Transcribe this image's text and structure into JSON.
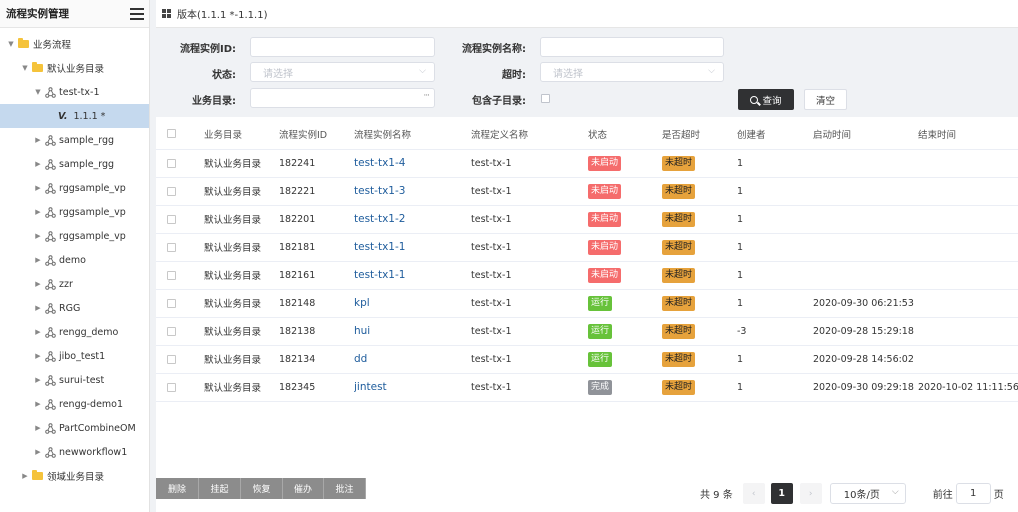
{
  "sidebar": {
    "title": "流程实例管理",
    "menu_icon": "hamburger-icon",
    "tree": [
      {
        "label": "业务流程",
        "level": 0,
        "type": "folder",
        "expanded": true
      },
      {
        "label": "默认业务目录",
        "level": 1,
        "type": "folder",
        "expanded": true
      },
      {
        "label": "test-tx-1",
        "level": 2,
        "type": "workflow",
        "expanded": true
      },
      {
        "label": "1.1.1 *",
        "level": 3,
        "type": "version",
        "mark": "V.",
        "selected": true
      },
      {
        "label": "sample_rgg",
        "level": 2,
        "type": "workflow"
      },
      {
        "label": "sample_rgg",
        "level": 2,
        "type": "workflow"
      },
      {
        "label": "rggsample_vp",
        "level": 2,
        "type": "workflow"
      },
      {
        "label": "rggsample_vp",
        "level": 2,
        "type": "workflow"
      },
      {
        "label": "rggsample_vp",
        "level": 2,
        "type": "workflow"
      },
      {
        "label": "demo",
        "level": 2,
        "type": "workflow"
      },
      {
        "label": "zzr",
        "level": 2,
        "type": "workflow"
      },
      {
        "label": "RGG",
        "level": 2,
        "type": "workflow"
      },
      {
        "label": "rengg_demo",
        "level": 2,
        "type": "workflow"
      },
      {
        "label": "jibo_test1",
        "level": 2,
        "type": "workflow"
      },
      {
        "label": "surui-test",
        "level": 2,
        "type": "workflow"
      },
      {
        "label": "rengg-demo1",
        "level": 2,
        "type": "workflow"
      },
      {
        "label": "PartCombineOM",
        "level": 2,
        "type": "workflow"
      },
      {
        "label": "newworkflow1",
        "level": 2,
        "type": "workflow"
      },
      {
        "label": "领域业务目录",
        "level": 1,
        "type": "folder",
        "expanded": false
      }
    ]
  },
  "header": {
    "title": "版本(1.1.1 *-1.1.1)"
  },
  "filter": {
    "instance_id_label": "流程实例ID:",
    "instance_id_value": "",
    "instance_name_label": "流程实例名称:",
    "instance_name_value": "",
    "status_label": "状态:",
    "status_placeholder": "请选择",
    "timeout_label": "超时:",
    "timeout_placeholder": "请选择",
    "catalog_label": "业务目录:",
    "catalog_value": "",
    "include_sub_label": "包含子目录:",
    "query_label": "查询",
    "clear_label": "清空"
  },
  "table": {
    "columns": [
      "业务目录",
      "流程实例ID",
      "流程实例名称",
      "流程定义名称",
      "状态",
      "是否超时",
      "创建者",
      "启动时间",
      "结束时间"
    ],
    "rows": [
      {
        "catalog": "默认业务目录",
        "id": "182241",
        "name": "test-tx1-4",
        "def": "test-tx-1",
        "status": "未启动",
        "timeout": "未超时",
        "creator": "1",
        "start": "",
        "end": ""
      },
      {
        "catalog": "默认业务目录",
        "id": "182221",
        "name": "test-tx1-3",
        "def": "test-tx-1",
        "status": "未启动",
        "timeout": "未超时",
        "creator": "1",
        "start": "",
        "end": ""
      },
      {
        "catalog": "默认业务目录",
        "id": "182201",
        "name": "test-tx1-2",
        "def": "test-tx-1",
        "status": "未启动",
        "timeout": "未超时",
        "creator": "1",
        "start": "",
        "end": ""
      },
      {
        "catalog": "默认业务目录",
        "id": "182181",
        "name": "test-tx1-1",
        "def": "test-tx-1",
        "status": "未启动",
        "timeout": "未超时",
        "creator": "1",
        "start": "",
        "end": ""
      },
      {
        "catalog": "默认业务目录",
        "id": "182161",
        "name": "test-tx1-1",
        "def": "test-tx-1",
        "status": "未启动",
        "timeout": "未超时",
        "creator": "1",
        "start": "",
        "end": ""
      },
      {
        "catalog": "默认业务目录",
        "id": "182148",
        "name": "kpl",
        "def": "test-tx-1",
        "status": "运行",
        "timeout": "未超时",
        "creator": "1",
        "start": "2020-09-30 06:21:53",
        "end": ""
      },
      {
        "catalog": "默认业务目录",
        "id": "182138",
        "name": "hui",
        "def": "test-tx-1",
        "status": "运行",
        "timeout": "未超时",
        "creator": "-3",
        "start": "2020-09-28 15:29:18",
        "end": ""
      },
      {
        "catalog": "默认业务目录",
        "id": "182134",
        "name": "dd",
        "def": "test-tx-1",
        "status": "运行",
        "timeout": "未超时",
        "creator": "1",
        "start": "2020-09-28 14:56:02",
        "end": ""
      },
      {
        "catalog": "默认业务目录",
        "id": "182345",
        "name": "jintest",
        "def": "test-tx-1",
        "status": "完成",
        "timeout": "未超时",
        "creator": "1",
        "start": "2020-09-30 09:29:18",
        "end": "2020-10-02 11:11:56"
      }
    ]
  },
  "status_colors": {
    "未启动": "#f56c6c",
    "运行": "#67c23a",
    "完成": "#909399",
    "未超时": "#e6a23c"
  },
  "actions": [
    "删除",
    "挂起",
    "恢复",
    "催办",
    "批注"
  ],
  "pagination": {
    "total": "共 9 条",
    "prev": "‹",
    "current": "1",
    "next": "›",
    "page_size": "10条/页",
    "goto_label": "前往",
    "goto_value": "1",
    "page_unit": "页"
  }
}
